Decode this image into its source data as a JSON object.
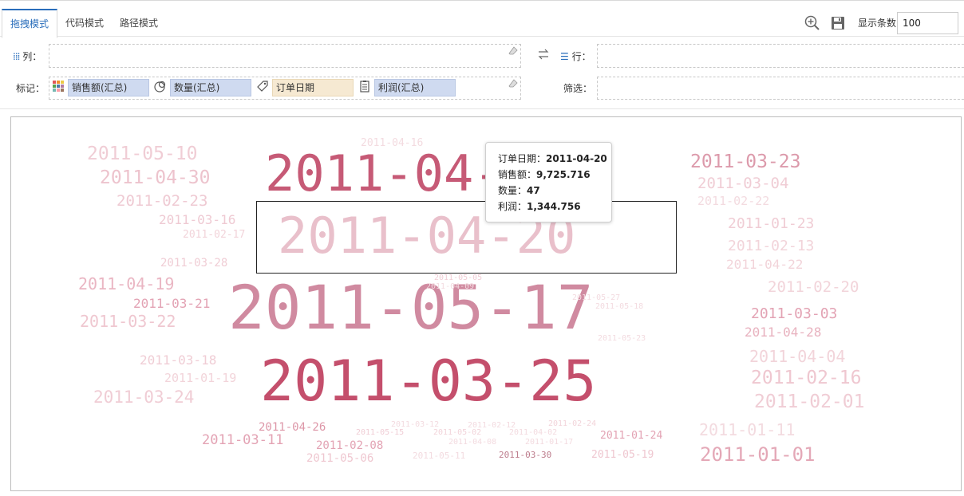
{
  "tabs": [
    "拖拽模式",
    "代码模式",
    "路径模式"
  ],
  "toolbar": {
    "count_label": "显示条数",
    "count_value": "100",
    "icons": [
      "zoom-in-icon",
      "save-icon"
    ]
  },
  "shelves": {
    "columns_label": "列：",
    "rows_label": "行：",
    "marks_label": "标记：",
    "filter_label": "筛选：",
    "marks": [
      {
        "icon": "color-grid-icon",
        "field": "销售额(汇总)"
      },
      {
        "icon": "size-icon",
        "field": "数量(汇总)"
      },
      {
        "icon": "label-tag-icon",
        "field": "订单日期"
      },
      {
        "icon": "detail-doc-icon",
        "field": "利润(汇总)"
      }
    ]
  },
  "tooltip": {
    "rows": [
      {
        "label": "订单日期：",
        "value": "2011-04-20"
      },
      {
        "label": "销售额：",
        "value": "9,725.716"
      },
      {
        "label": "数量：",
        "value": "47"
      },
      {
        "label": "利润：",
        "value": "1,344.756"
      }
    ]
  },
  "word_cloud": {
    "words": [
      "2011-05-17",
      "2011-03-25",
      "2011-04-20",
      "2011-04-14",
      "2011-05-10",
      "2011-04-30",
      "2011-02-23",
      "2011-03-16",
      "2011-02-17",
      "2011-03-28",
      "2011-04-19",
      "2011-03-21",
      "2011-03-22",
      "2011-03-18",
      "2011-01-19",
      "2011-03-24",
      "2011-04-26",
      "2011-03-11",
      "2011-02-08",
      "2011-05-06",
      "2011-04-16",
      "2011-03-23",
      "2011-03-04",
      "2011-02-22",
      "2011-01-23",
      "2011-02-13",
      "2011-04-22",
      "2011-02-20",
      "2011-03-03",
      "2011-04-28",
      "2011-04-04",
      "2011-02-16",
      "2011-02-01",
      "2011-01-11",
      "2011-01-01",
      "2011-01-24",
      "2011-05-19",
      "2011-03-30",
      "2011-05-11",
      "2011-03-12",
      "2011-02-24",
      "2011-05-15",
      "2011-05-02",
      "2011-04-08",
      "2011-01-17",
      "2011-04-02",
      "2011-02-12",
      "2011-05-05",
      "2011-04-09",
      "2011-05-27",
      "2011-05-18",
      "2011-05-23"
    ]
  }
}
